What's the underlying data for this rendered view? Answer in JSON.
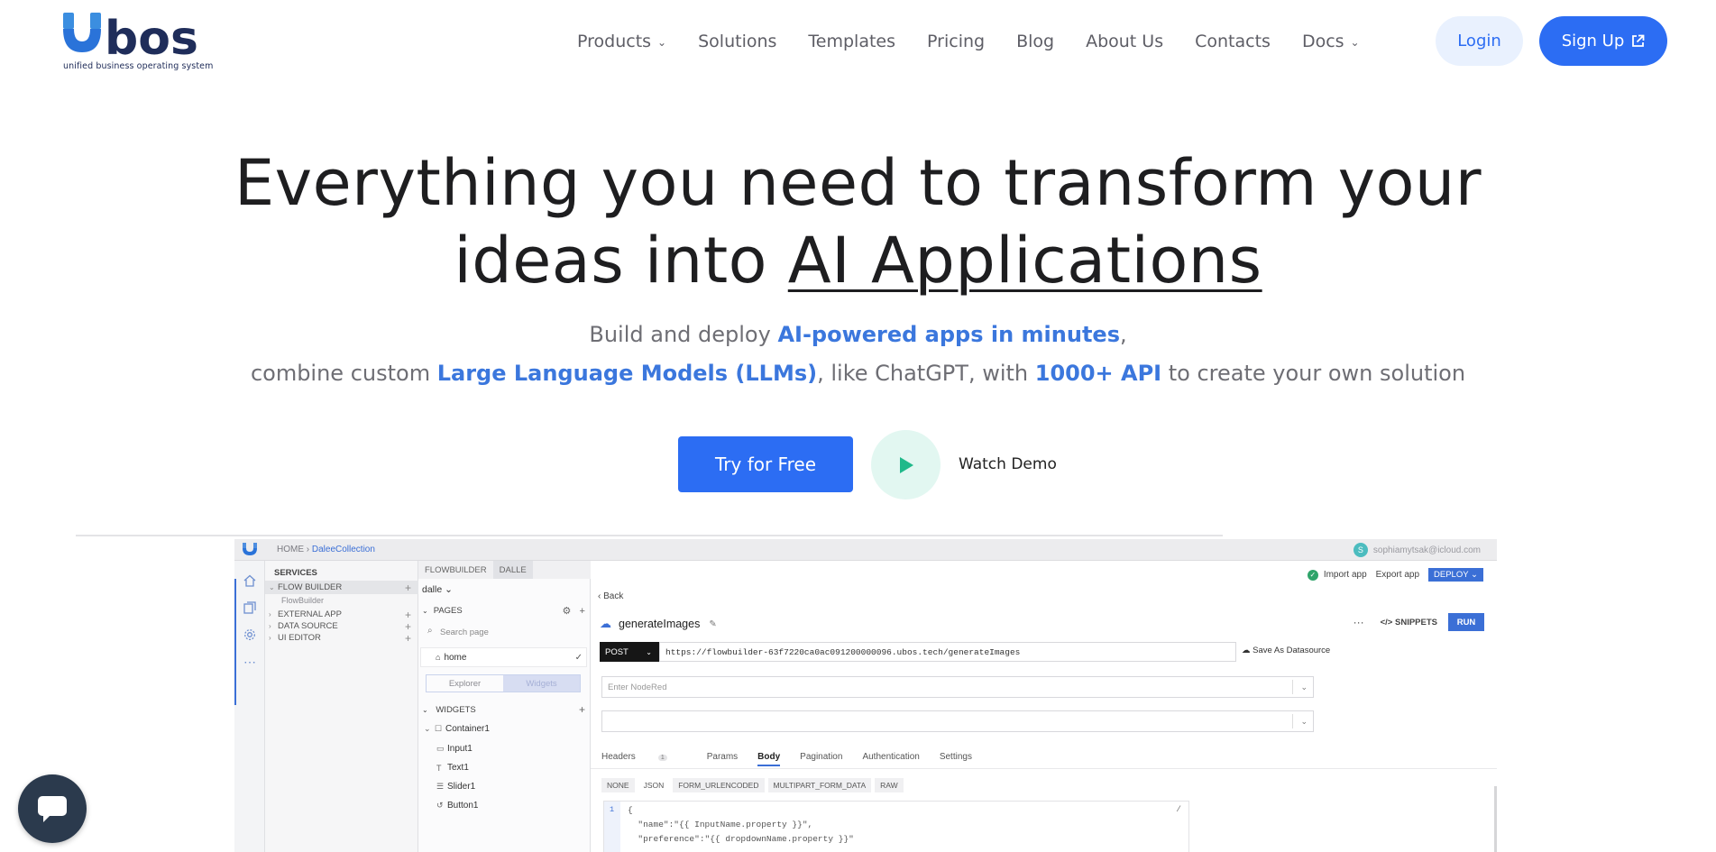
{
  "brand": {
    "name": "bos",
    "tagline": "unified business operating system"
  },
  "nav": {
    "items": [
      {
        "label": "Products",
        "dropdown": true
      },
      {
        "label": "Solutions",
        "dropdown": false
      },
      {
        "label": "Templates",
        "dropdown": false
      },
      {
        "label": "Pricing",
        "dropdown": false
      },
      {
        "label": "Blog",
        "dropdown": false
      },
      {
        "label": "About Us",
        "dropdown": false
      },
      {
        "label": "Contacts",
        "dropdown": false
      },
      {
        "label": "Docs",
        "dropdown": true
      }
    ],
    "login_label": "Login",
    "signup_label": "Sign Up"
  },
  "hero": {
    "title_line1": "Everything you need to transform your",
    "title_line2_prefix": "ideas into ",
    "title_line2_underlined": "AI Applications",
    "sub_line1_prefix": "Build and deploy ",
    "sub_line1_highlight": "AI-powered apps in minutes",
    "sub_line1_suffix": ",",
    "sub_line2_prefix": "combine custom ",
    "sub_line2_highlight1": "Large Language Models (LLMs)",
    "sub_line2_middle": ", like ChatGPT, with ",
    "sub_line2_highlight2": "1000+ API",
    "sub_line2_suffix": " to create your own solution",
    "cta_label": "Try for Free",
    "watch_demo_label": "Watch Demo"
  },
  "app": {
    "breadcrumb_home": "HOME",
    "breadcrumb_sep": " › ",
    "breadcrumb_current": "DaleeCollection",
    "user_initial": "S",
    "user_email": "sophiamytsak@icloud.com",
    "services": {
      "heading": "SERVICES",
      "items": [
        {
          "label": "FLOW BUILDER",
          "sub": "FlowBuilder"
        },
        {
          "label": "EXTERNAL APP"
        },
        {
          "label": "DATA SOURCE"
        },
        {
          "label": "UI EDITOR"
        }
      ]
    },
    "pages_panel": {
      "tab1": "FLOWBUILDER",
      "tab2": "DALLE",
      "app_select": "dalle",
      "pages_heading": "PAGES",
      "search_placeholder": "Search page",
      "home_page": "home",
      "seg_explorer": "Explorer",
      "seg_widgets": "Widgets",
      "widgets_heading": "WIDGETS",
      "widgets": [
        "Container1",
        "Input1",
        "Text1",
        "Slider1",
        "Button1"
      ]
    },
    "editor": {
      "import_label": "Import app",
      "export_label": "Export app",
      "deploy_label": "DEPLOY",
      "back_label": "Back",
      "api_name": "generateImages",
      "snippets_label": "SNIPPETS",
      "run_label": "RUN",
      "method": "POST",
      "url": "https://flowbuilder-63f7220ca0ac091200000096.ubos.tech/generateImages",
      "save_ds_label": "Save As Datasource",
      "nodered_placeholder": "Enter NodeRed",
      "request_tabs": [
        {
          "label": "Headers",
          "badge": "1"
        },
        {
          "label": "Params"
        },
        {
          "label": "Body"
        },
        {
          "label": "Pagination"
        },
        {
          "label": "Authentication"
        },
        {
          "label": "Settings"
        }
      ],
      "active_request_tab": "Body",
      "body_types": [
        "NONE",
        "JSON",
        "FORM_URLENCODED",
        "MULTIPART_FORM_DATA",
        "RAW"
      ],
      "active_body_type": "JSON",
      "code_gutter": "1",
      "code_line1": "{",
      "code_line2": "  \"name\":\"{{ InputName.property }}\",",
      "code_line3": "  \"preference\":\"{{ dropdownName.property }}\""
    }
  },
  "colors": {
    "primary": "#2c6df3",
    "login_bg": "#e9f1fe",
    "highlight": "#3b77dd",
    "play_bg": "#e2f7f1",
    "play_icon": "#1fb98a",
    "chat_bg": "#2b3a4d"
  }
}
